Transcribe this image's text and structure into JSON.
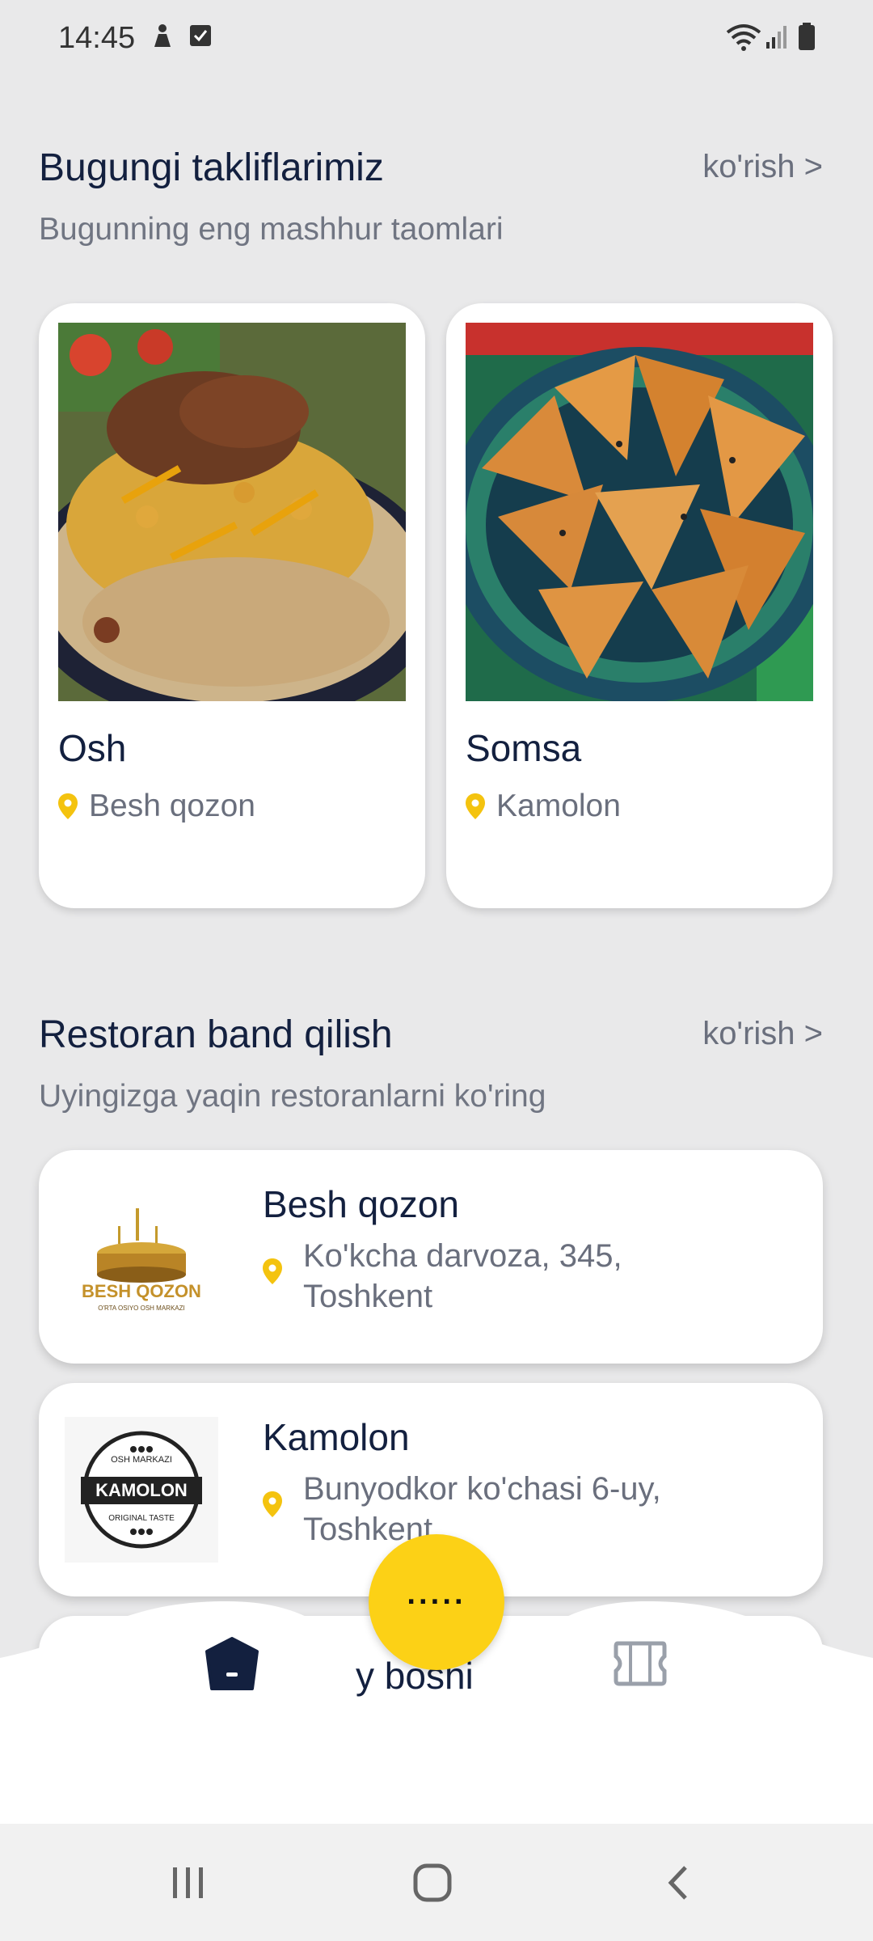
{
  "status_bar": {
    "time": "14:45"
  },
  "offers": {
    "title": "Bugungi takliflarimiz",
    "link": "ko'rish >",
    "subtitle": "Bugunning eng mashhur taomlari",
    "items": [
      {
        "name": "Osh",
        "location": "Besh qozon",
        "image": "plov-photo"
      },
      {
        "name": "Somsa",
        "location": "Kamolon",
        "image": "samsa-photo"
      }
    ]
  },
  "restaurants": {
    "title": "Restoran band qilish",
    "link": "ko'rish >",
    "subtitle": "Uyingizga yaqin restoranlarni ko'ring",
    "items": [
      {
        "name": "Besh qozon",
        "address_line1": "Ko'kcha darvoza, 345,",
        "address_line2": "Toshkent",
        "logo_main": "BESH QOZON",
        "logo_sub": "O'RTA OSIYO OSH MARKAZI"
      },
      {
        "name": "Kamolon",
        "address_line1": "Bunyodkor ko'chasi 6-uy,",
        "address_line2": "Toshkent",
        "logo_main": "KAMOLON",
        "logo_top": "OSH MARKAZI",
        "logo_sub": "ORIGINAL TASTE"
      }
    ]
  },
  "bottom_nav": {
    "home_label": "y boshi",
    "fab_label": "·····"
  },
  "colors": {
    "accent": "#fcd116",
    "dark": "#13203f",
    "muted": "#6a6f7d",
    "background": "#e9e9ea"
  }
}
